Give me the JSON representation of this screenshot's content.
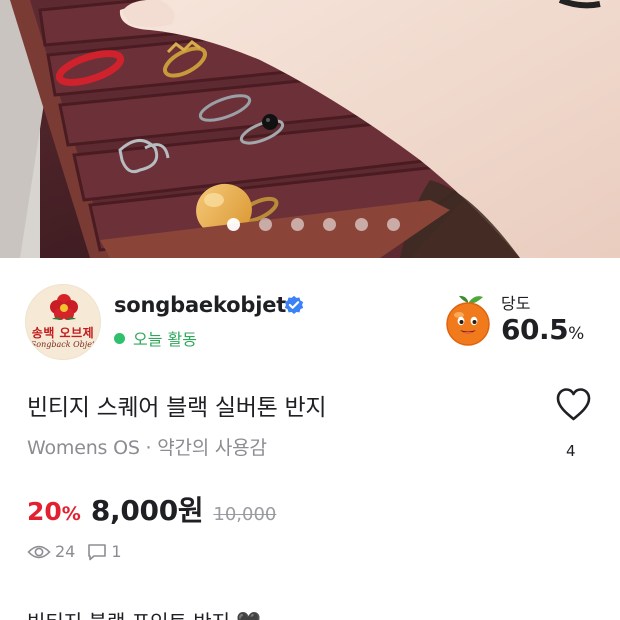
{
  "gallery": {
    "slide_count": 6,
    "active_index": 0
  },
  "seller": {
    "name": "songbaekobjet",
    "status": "오늘 활동",
    "avatar_text_ko": "송백 오브제",
    "avatar_text_en": "Songback Objet"
  },
  "manner": {
    "label": "당도",
    "value": "60.5",
    "unit": "%"
  },
  "product": {
    "title": "빈티지 스퀘어 블랙 실버톤 반지",
    "category": "Womens OS · 약간의 사용감",
    "discount": "20",
    "discount_unit": "%",
    "price": "8,000원",
    "original_price": "10,000",
    "likes": "4",
    "views": "24",
    "chats": "1",
    "description_preview": "빈티지 블랙 포인트 반지 🖤"
  },
  "colors": {
    "accent_red": "#e2202f",
    "active_green": "#2fc06b",
    "verified_blue": "#3b82f6"
  }
}
